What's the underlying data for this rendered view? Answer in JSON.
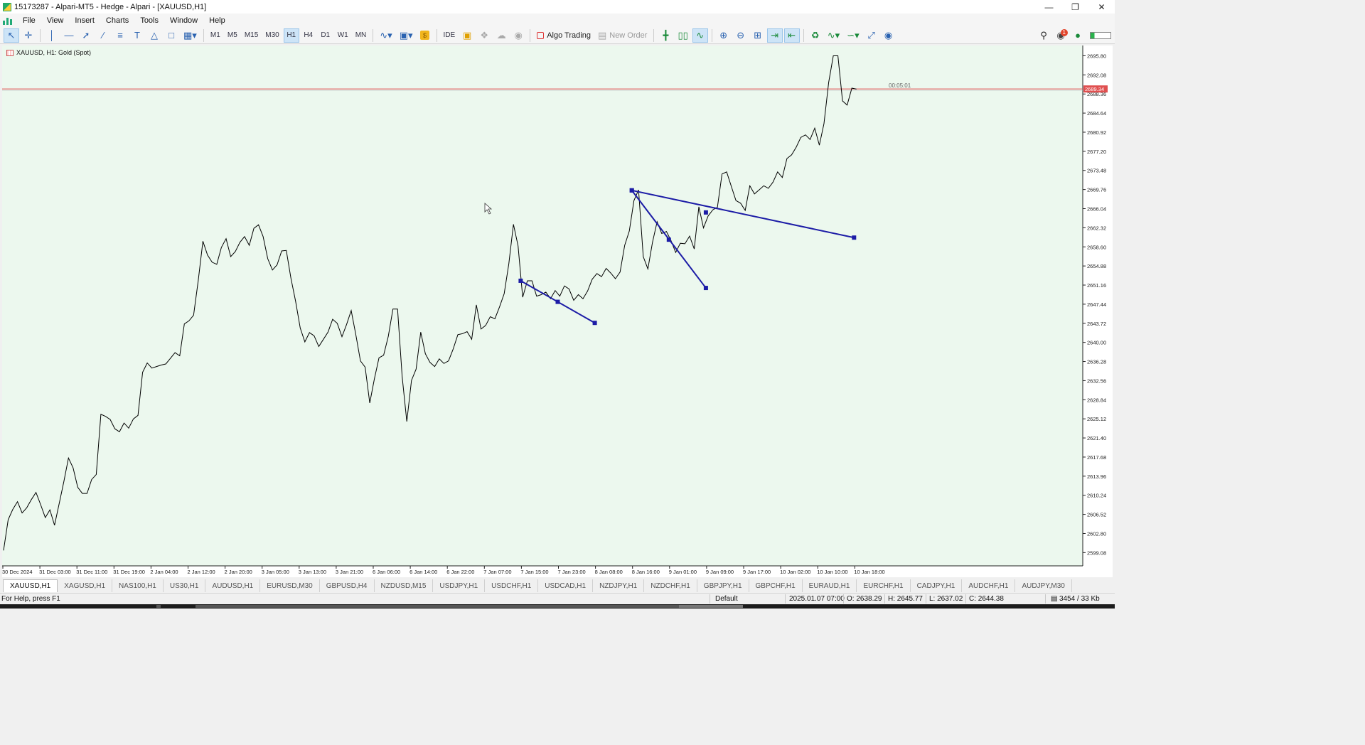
{
  "window": {
    "title": "15173287 - Alpari-MT5 - Hedge - Alpari - [XAUUSD,H1]",
    "controls": [
      "minimize-icon",
      "restore-icon",
      "close-icon"
    ]
  },
  "menu": [
    "File",
    "View",
    "Insert",
    "Charts",
    "Tools",
    "Window",
    "Help"
  ],
  "toolbar": {
    "timeframes": [
      "M1",
      "M5",
      "M15",
      "M30",
      "H1",
      "H4",
      "D1",
      "W1",
      "MN"
    ],
    "active_timeframe": "H1",
    "ide_label": "IDE",
    "algo_trading_label": "Algo Trading",
    "new_order_label": "New Order",
    "notification_count": "1"
  },
  "chart": {
    "label": "XAUUSD, H1:  Gold (Spot)",
    "current_price": "2689.34",
    "countdown": "00:05:01",
    "line_color": "#000000",
    "trendline_color": "#1c1ca6",
    "bid_line_color": "#e05050",
    "background": "#ecf8ee"
  },
  "chart_data": {
    "type": "line",
    "symbol": "XAUUSD",
    "timeframe": "H1",
    "ylim": [
      2596.5,
      2697.8
    ],
    "y_ticks": [
      "2695.80",
      "2692.08",
      "2688.36",
      "2684.64",
      "2680.92",
      "2677.20",
      "2673.48",
      "2669.76",
      "2666.04",
      "2662.32",
      "2658.60",
      "2654.88",
      "2651.16",
      "2647.44",
      "2643.72",
      "2640.00",
      "2636.28",
      "2632.56",
      "2628.84",
      "2625.12",
      "2621.40",
      "2617.68",
      "2613.96",
      "2610.24",
      "2606.52",
      "2602.80",
      "2599.08"
    ],
    "x_ticks": [
      "30 Dec 2024",
      "31 Dec 03:00",
      "31 Dec 11:00",
      "31 Dec 19:00",
      "2 Jan 04:00",
      "2 Jan 12:00",
      "2 Jan 20:00",
      "3 Jan 05:00",
      "3 Jan 13:00",
      "3 Jan 21:00",
      "6 Jan 06:00",
      "6 Jan 14:00",
      "6 Jan 22:00",
      "7 Jan 07:00",
      "7 Jan 15:00",
      "7 Jan 23:00",
      "8 Jan 08:00",
      "8 Jan 16:00",
      "9 Jan 01:00",
      "9 Jan 09:00",
      "9 Jan 17:00",
      "10 Jan 02:00",
      "10 Jan 10:00",
      "10 Jan 18:00"
    ],
    "close_prices": [
      2599.5,
      2605.5,
      2607.5,
      2609.0,
      2606.8,
      2607.8,
      2609.4,
      2610.8,
      2608.4,
      2605.9,
      2607.4,
      2604.4,
      2608.6,
      2612.9,
      2617.5,
      2615.6,
      2611.8,
      2610.6,
      2610.6,
      2613.3,
      2614.3,
      2626.0,
      2625.6,
      2625.0,
      2623.2,
      2622.6,
      2624.3,
      2623.3,
      2625.1,
      2625.8,
      2634.2,
      2636.0,
      2635.0,
      2635.3,
      2635.6,
      2635.8,
      2636.9,
      2638.0,
      2637.4,
      2643.6,
      2644.2,
      2645.3,
      2652.0,
      2659.7,
      2657.0,
      2655.6,
      2655.2,
      2658.5,
      2660.2,
      2656.7,
      2657.7,
      2659.5,
      2660.6,
      2658.9,
      2662.2,
      2662.9,
      2660.6,
      2656.3,
      2654.1,
      2655.1,
      2657.8,
      2657.9,
      2652.5,
      2648.0,
      2642.8,
      2640.1,
      2641.9,
      2641.3,
      2639.2,
      2640.6,
      2642.0,
      2644.5,
      2643.7,
      2641.1,
      2643.5,
      2646.2,
      2641.5,
      2636.4,
      2635.2,
      2628.2,
      2632.9,
      2637.0,
      2637.5,
      2641.2,
      2646.5,
      2646.5,
      2633.3,
      2624.6,
      2632.6,
      2634.8,
      2642.0,
      2637.8,
      2636.1,
      2635.3,
      2636.8,
      2635.9,
      2636.4,
      2638.7,
      2641.5,
      2641.7,
      2642.1,
      2640.6,
      2647.3,
      2642.6,
      2643.3,
      2645.0,
      2644.6,
      2646.9,
      2649.5,
      2655.3,
      2663.0,
      2658.8,
      2648.8,
      2652.0,
      2652.0,
      2649.0,
      2649.3,
      2649.8,
      2648.5,
      2650.1,
      2649.0,
      2651.0,
      2650.4,
      2648.2,
      2649.3,
      2648.5,
      2650.0,
      2652.3,
      2653.4,
      2652.8,
      2654.4,
      2653.5,
      2652.4,
      2653.7,
      2658.9,
      2661.7,
      2667.6,
      2669.7,
      2656.7,
      2654.3,
      2659.5,
      2663.5,
      2661.2,
      2661.6,
      2659.8,
      2657.5,
      2659.3,
      2659.2,
      2660.7,
      2658.2,
      2666.4,
      2662.3,
      2664.6,
      2665.8,
      2666.3,
      2672.8,
      2673.2,
      2670.4,
      2667.6,
      2667.1,
      2665.7,
      2670.5,
      2668.9,
      2669.7,
      2670.5,
      2670.0,
      2671.2,
      2673.2,
      2672.1,
      2675.8,
      2676.5,
      2678.0,
      2679.9,
      2680.4,
      2679.5,
      2681.7,
      2678.4,
      2682.6,
      2690.6,
      2695.8,
      2695.8,
      2687.0,
      2686.2,
      2689.5,
      2689.3
    ],
    "trendlines": [
      {
        "points": [
          [
            "7 Jan 15:00",
            2652.0
          ],
          [
            "7 Jan 23:00",
            2647.9
          ],
          [
            "8 Jan 08:00",
            2643.8
          ]
        ]
      },
      {
        "points": [
          [
            "8 Jan 16:00",
            2669.6
          ],
          [
            "9 Jan 09:00",
            2665.3
          ],
          [
            "10 Jan 18:00",
            2660.4
          ]
        ]
      },
      {
        "points": [
          [
            "8 Jan 16:00",
            2669.6
          ],
          [
            "9 Jan 01:00",
            2660.0
          ],
          [
            "9 Jan 09:00",
            2650.6
          ]
        ]
      }
    ],
    "grid": false,
    "legend": "none"
  },
  "symbol_tabs": [
    "XAUUSD,H1",
    "XAGUSD,H1",
    "NAS100,H1",
    "US30,H1",
    "AUDUSD,H1",
    "EURUSD,M30",
    "GBPUSD,H4",
    "NZDUSD,M15",
    "USDJPY,H1",
    "USDCHF,H1",
    "USDCAD,H1",
    "NZDJPY,H1",
    "NZDCHF,H1",
    "GBPJPY,H1",
    "GBPCHF,H1",
    "EURAUD,H1",
    "EURCHF,H1",
    "CADJPY,H1",
    "AUDCHF,H1",
    "AUDJPY,M30"
  ],
  "status": {
    "help": "For Help, press F1",
    "profile": "Default",
    "datetime": "2025.01.07 07:00",
    "open": "O: 2638.29",
    "high": "H: 2645.77",
    "low": "L: 2637.02",
    "close": "C: 2644.38",
    "traffic": "3454 / 33 Kb"
  }
}
